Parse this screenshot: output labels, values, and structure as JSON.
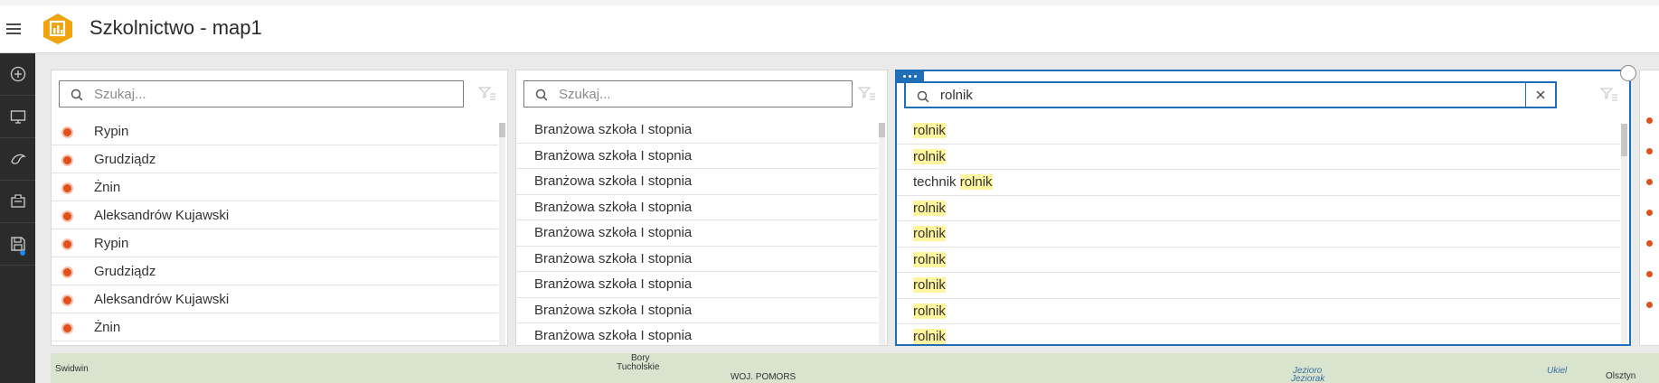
{
  "app": {
    "title": "Szkolnictwo - map1"
  },
  "sidebar": {
    "buttons": [
      {
        "name": "add-icon"
      },
      {
        "name": "display-icon"
      },
      {
        "name": "theme-icon"
      },
      {
        "name": "share-icon"
      },
      {
        "name": "save-icon"
      }
    ]
  },
  "panels": [
    {
      "search_placeholder": "Szukaj...",
      "search_value": "",
      "items": [
        "Rypin",
        "Grudziądz",
        "Żnin",
        "Aleksandrów Kujawski",
        "Rypin",
        "Grudziądz",
        "Aleksandrów Kujawski",
        "Żnin"
      ]
    },
    {
      "search_placeholder": "Szukaj...",
      "search_value": "",
      "items": [
        "Branżowa szkoła I stopnia",
        "Branżowa szkoła I stopnia",
        "Branżowa szkoła I stopnia",
        "Branżowa szkoła I stopnia",
        "Branżowa szkoła I stopnia",
        "Branżowa szkoła I stopnia",
        "Branżowa szkoła I stopnia",
        "Branżowa szkoła I stopnia",
        "Branżowa szkoła I stopnia"
      ]
    },
    {
      "search_placeholder": "Szukaj...",
      "search_value": "rolnik",
      "items": [
        {
          "prefix": "",
          "match": "rolnik"
        },
        {
          "prefix": "",
          "match": "rolnik"
        },
        {
          "prefix": "technik ",
          "match": "rolnik"
        },
        {
          "prefix": "",
          "match": "rolnik"
        },
        {
          "prefix": "",
          "match": "rolnik"
        },
        {
          "prefix": "",
          "match": "rolnik"
        },
        {
          "prefix": "",
          "match": "rolnik"
        },
        {
          "prefix": "",
          "match": "rolnik"
        },
        {
          "prefix": "",
          "match": "rolnik"
        }
      ]
    }
  ],
  "map": {
    "labels": [
      "Swidwin",
      "Bory",
      "Tucholskie",
      "WOJ. POMORS",
      "Jezioro",
      "Jeziorak",
      "Ukiel",
      "Olsztyn"
    ]
  },
  "colors": {
    "accent": "#1f6fb8",
    "marker": "#e0501b",
    "highlight": "#fff59e",
    "sidebar": "#2b2b2b"
  }
}
